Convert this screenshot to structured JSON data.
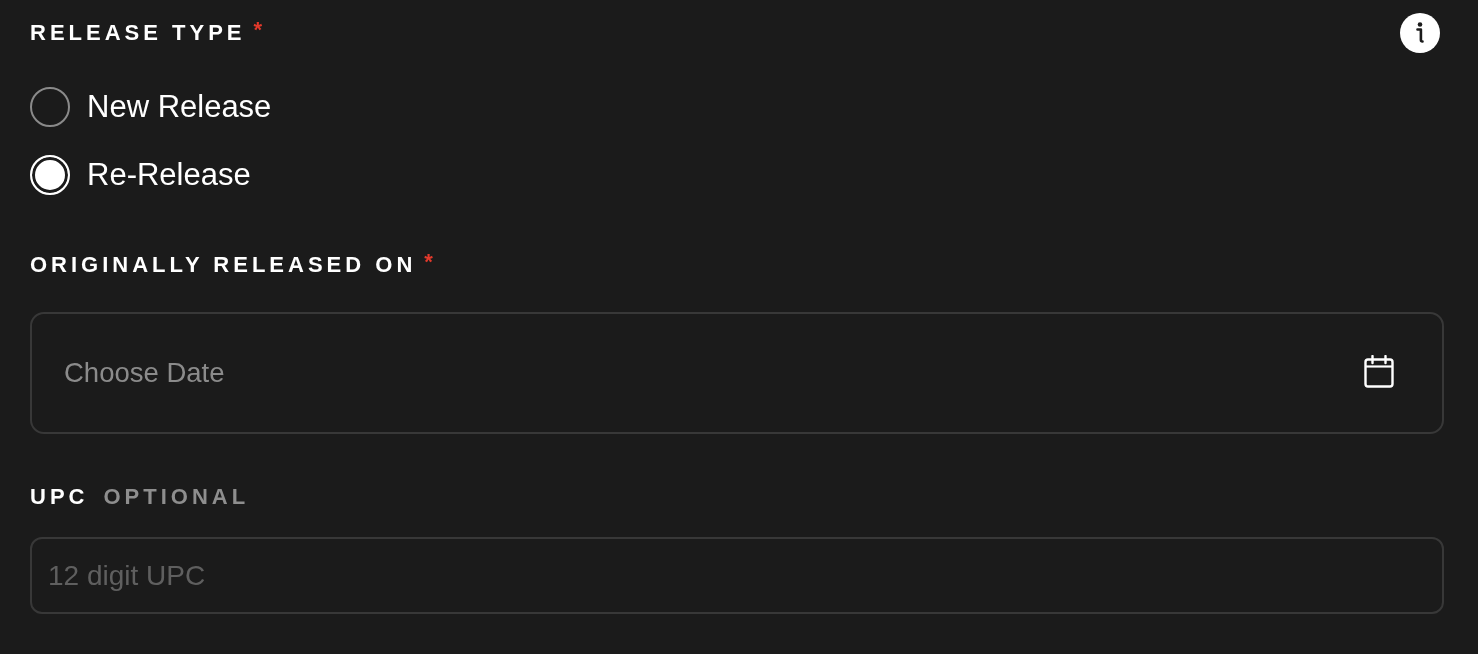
{
  "fields": [
    {
      "kind": "radio_group",
      "label": "RELEASE TYPE",
      "required_mark": "*",
      "options": [
        {
          "label": "New Release",
          "selected": false
        },
        {
          "label": "Re-Release",
          "selected": true
        }
      ]
    },
    {
      "kind": "date",
      "label": "ORIGINALLY RELEASED ON",
      "required_mark": "*",
      "placeholder": "Choose Date"
    },
    {
      "kind": "text",
      "label": "UPC",
      "optional_tag": "OPTIONAL",
      "placeholder": "12 digit UPC"
    }
  ]
}
